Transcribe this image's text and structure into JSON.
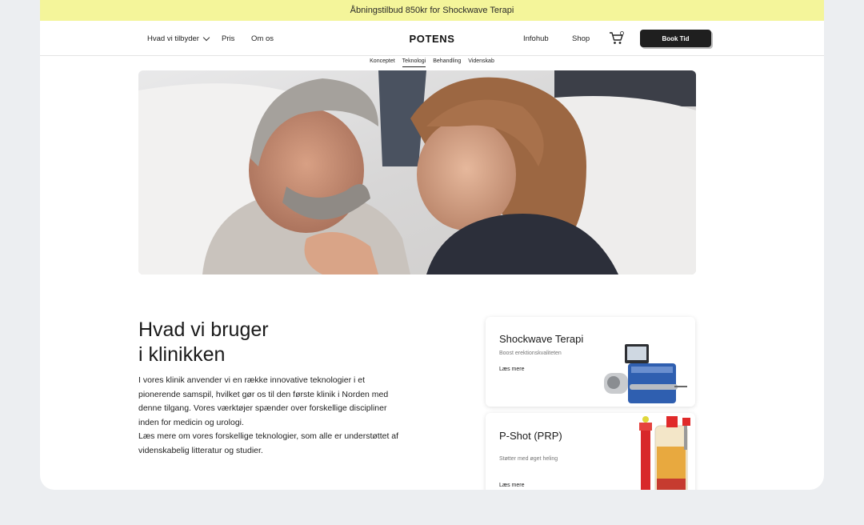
{
  "promo": {
    "text": "Åbningstilbud 850kr for Shockwave Terapi"
  },
  "nav": {
    "offer_label": "Hvad vi tilbyder",
    "price_label": "Pris",
    "about_label": "Om os",
    "logo": "POTENS",
    "infohub_label": "Infohub",
    "shop_label": "Shop",
    "book_label": "Book Tid"
  },
  "subnav": {
    "items": [
      "Konceptet",
      "Teknologi",
      "Behandling",
      "Videnskab"
    ],
    "active": "Teknologi"
  },
  "section": {
    "heading_line1": "Hvad vi bruger",
    "heading_line2": "i klinikken",
    "body_p1": "I vores klinik anvender vi en række innovative teknologier i et pionerende samspil, hvilket gør os til den første klinik i Norden med denne tilgang. Vores værktøjer spænder over forskellige discipliner inden for medicin og urologi.",
    "body_p2": "Læs mere om vores forskellige teknologier, som alle er understøttet af videnskabelig litteratur og studier."
  },
  "cards": [
    {
      "title": "Shockwave Terapi",
      "subtitle": "Boost erektionskvaliteten",
      "link": "Læs mere"
    },
    {
      "title": "P-Shot (PRP)",
      "subtitle": "Støtter med øget heling",
      "link": "Læs mere"
    }
  ],
  "colors": {
    "promo_bg": "#f4f59a",
    "button_bg": "#1f1f1f",
    "page_bg": "#eceef1"
  }
}
